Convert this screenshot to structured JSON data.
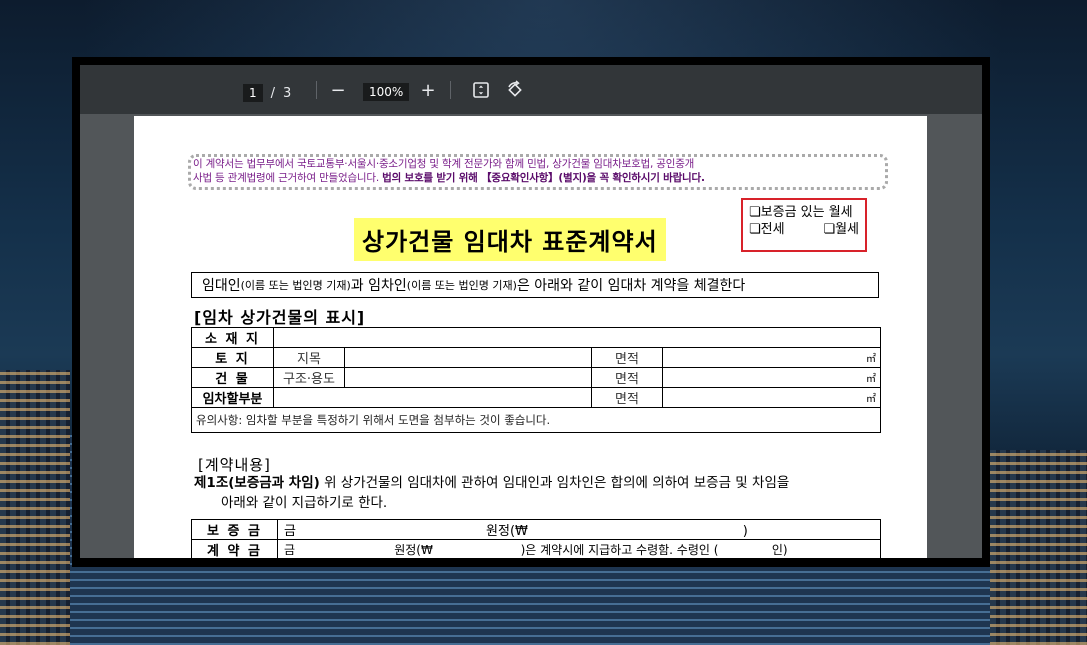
{
  "toolbar": {
    "current_page": "1",
    "page_sep": "/",
    "total_pages": "3",
    "zoom_out": "−",
    "zoom": "100%",
    "zoom_in": "+",
    "fit_icon": "fit-page-icon",
    "rotate_icon": "rotate-icon"
  },
  "document": {
    "notice_line1": "이 계약서는 법무부에서 국토교통부·서울시·중소기업청 및 학계 전문가와 함께 민법, 상가건물 임대차보호법, 공인중개",
    "notice_line2": "사법 등 관계법령에 근거하여 만들었습니다.",
    "notice_bold": "법의 보호를 받기 위해 【중요확인사항】(별지)을 꼭 확인하시기 바랍니다.",
    "title": "상가건물 임대차 표준계약서",
    "lease_type": {
      "opt1": "❏보증금 있는 월세",
      "opt2": "❏전세",
      "opt3": "❏월세"
    },
    "parties": {
      "a": "임대인",
      "a_note": "(이름 또는 법인명 기재)",
      "b": "과 임차인",
      "b_note": "(이름 또는 법인명 기재)",
      "c": "은 아래와 같이 임대차 계약을 체결한다"
    },
    "section1": "[임차 상가건물의 표시]",
    "table": {
      "row_location": "소 재 지",
      "row_land": "토    지",
      "land_sub": "지목",
      "row_building": "건    물",
      "building_sub": "구조·용도",
      "row_lease_part": "임차할부분",
      "area": "면적",
      "unit": "㎡",
      "note": "유의사항: 임차할 부분을 특정하기 위해서 도면을 첨부하는 것이 좋습니다."
    },
    "section2": "[계약내용]",
    "art1_title": "제1조(보증금과 차임)",
    "art1_text1": " 위 상가건물의 임대차에 관하여 임대인과 임차인은 합의에 의하여 보증금 및 차임을",
    "art1_text2": "아래와 같이 지급하기로 한다.",
    "payment": {
      "deposit": "보 증 금",
      "deposit_value": "금                                              원정(₩                                                    )",
      "contract": "계 약 금",
      "contract_value": "금                          원정(₩                       )은 계약시에 지급하고 수령함. 수령인 (              인)"
    }
  }
}
